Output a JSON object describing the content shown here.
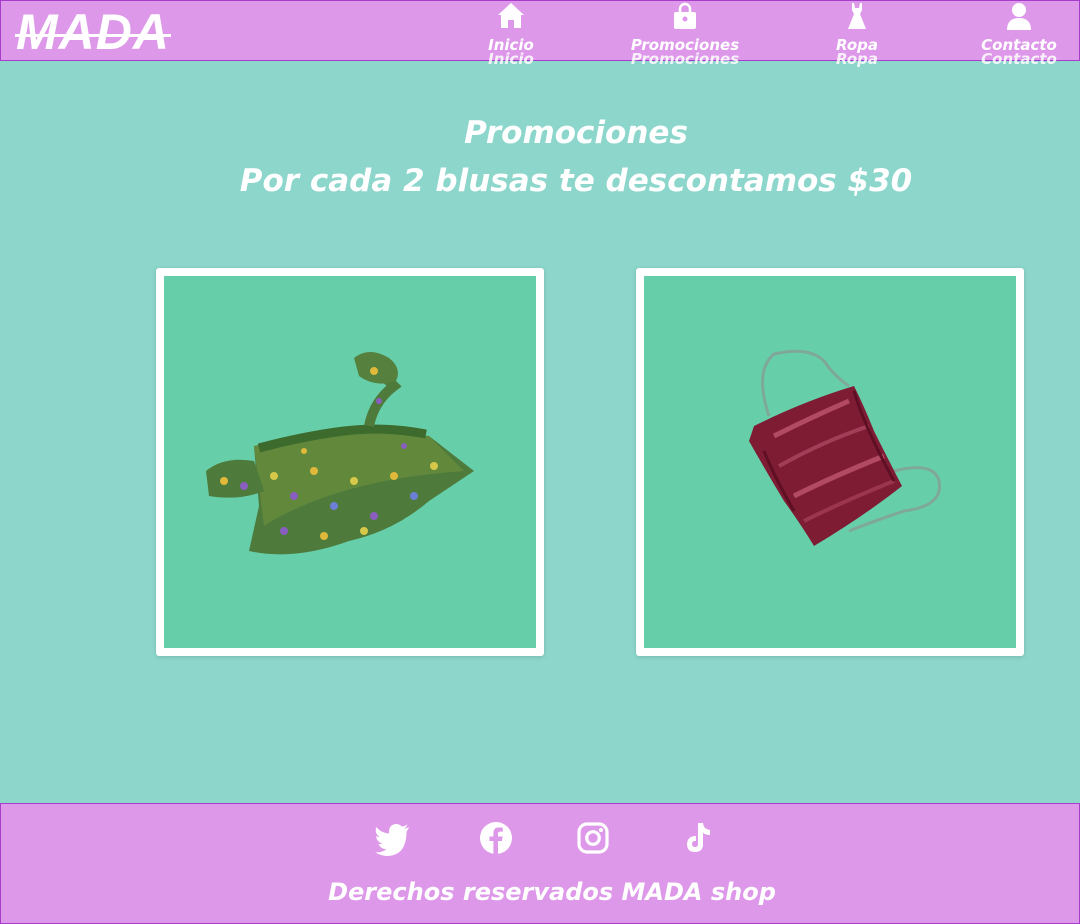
{
  "header": {
    "logo": "MADA",
    "nav": [
      {
        "label": "Inicio",
        "icon": "home-icon"
      },
      {
        "label": "Promociones",
        "icon": "shopping-bag-icon"
      },
      {
        "label": "Ropa",
        "icon": "dress-icon"
      },
      {
        "label": "Contacto",
        "icon": "user-icon"
      }
    ]
  },
  "main": {
    "title": "Promociones",
    "subtitle": "Por cada 2 blusas te descontamos $30",
    "products": [
      {
        "image": "floral-ruffle-top-image"
      },
      {
        "image": "burgundy-satin-top-image"
      }
    ]
  },
  "footer": {
    "social": [
      "twitter-icon",
      "facebook-icon",
      "instagram-icon",
      "tiktok-icon"
    ],
    "copyright": "Derechos reservados MADA shop"
  },
  "colors": {
    "background": "#8dd6cc",
    "bar": "#de98ea",
    "bar_border": "#a63bcc",
    "card_bg": "#66cfaa",
    "text": "#ffffff"
  }
}
